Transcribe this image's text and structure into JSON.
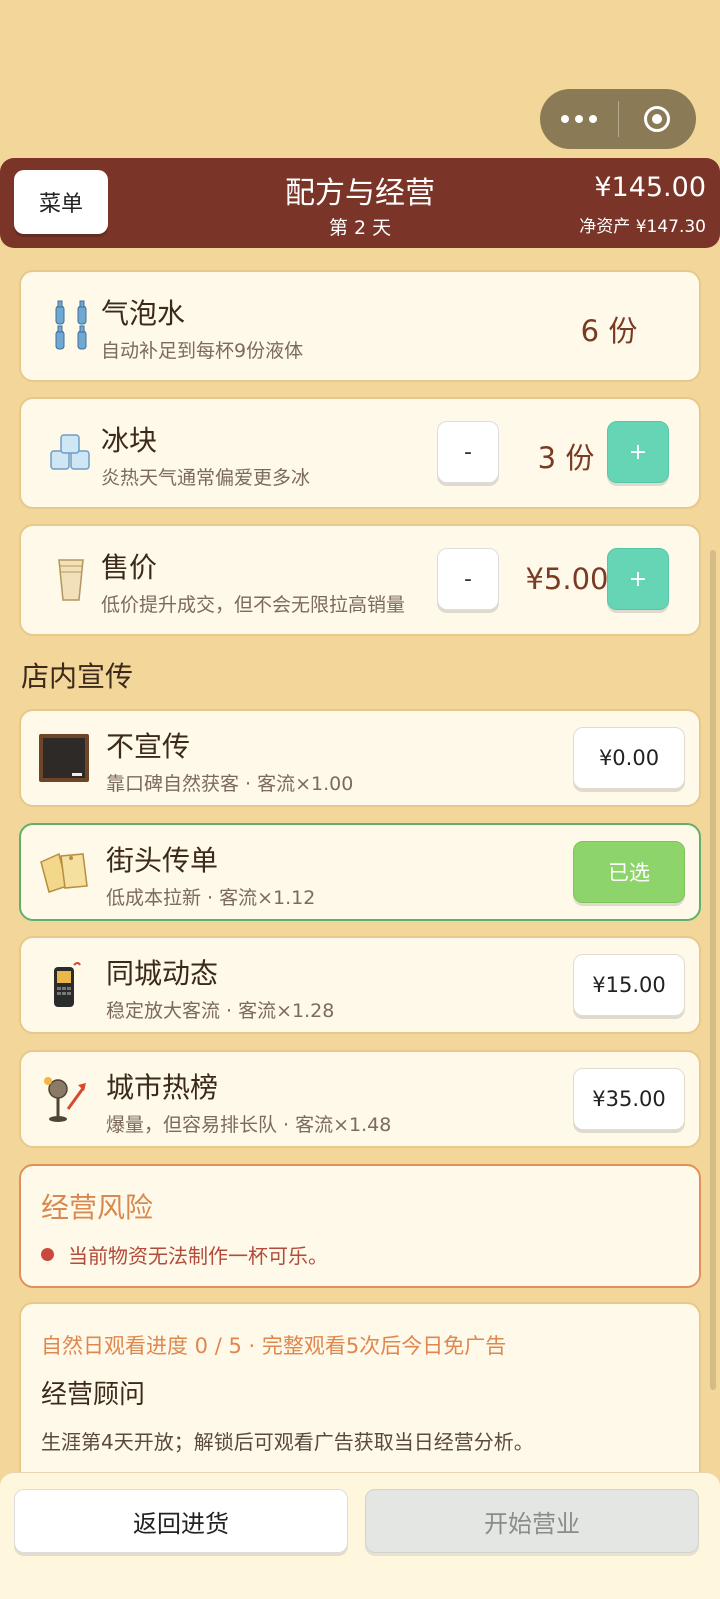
{
  "header": {
    "menu_label": "菜单",
    "title": "配方与经营",
    "day": "第 2 天",
    "money": "¥145.00",
    "net_worth": "净资产 ¥147.30"
  },
  "ingredients": [
    {
      "icon": "soda-bottles-icon",
      "name": "气泡水",
      "desc": "自动补足到每杯9份液体",
      "value": "6 份"
    },
    {
      "icon": "ice-cubes-icon",
      "name": "冰块",
      "desc": "炎热天气通常偏爱更多冰",
      "value": "3 份",
      "minus": "-",
      "plus": "+"
    },
    {
      "icon": "paper-cups-icon",
      "name": "售价",
      "desc": "低价提升成交，但不会无限拉高销量",
      "value": "¥5.00",
      "minus": "-",
      "plus": "+"
    }
  ],
  "promo": {
    "section_title": "店内宣传",
    "options": [
      {
        "icon": "chalkboard-icon",
        "name": "不宣传",
        "desc": "靠口碑自然获客 · 客流×1.00",
        "button": "¥0.00",
        "selected": false
      },
      {
        "icon": "flyers-icon",
        "name": "街头传单",
        "desc": "低成本拉新 · 客流×1.12",
        "button": "已选",
        "selected": true
      },
      {
        "icon": "phone-icon",
        "name": "同城动态",
        "desc": "稳定放大客流 · 客流×1.28",
        "button": "¥15.00",
        "selected": false
      },
      {
        "icon": "trending-mic-icon",
        "name": "城市热榜",
        "desc": "爆量，但容易排长队 · 客流×1.48",
        "button": "¥35.00",
        "selected": false
      }
    ]
  },
  "risk": {
    "title": "经营风险",
    "items": [
      "当前物资无法制作一杯可乐。"
    ]
  },
  "advisor": {
    "progress": "自然日观看进度 0 / 5 · 完整观看5次后今日免广告",
    "title": "经营顾问",
    "desc": "生涯第4天开放；解锁后可观看广告获取当日经营分析。"
  },
  "bottom": {
    "back_label": "返回进货",
    "start_label": "开始营业"
  },
  "colors": {
    "background": "#f3d69a",
    "header": "#7a3528",
    "plus_button": "#65d5b6",
    "selected_button": "#8dd46a",
    "risk_border": "#e0905c"
  }
}
